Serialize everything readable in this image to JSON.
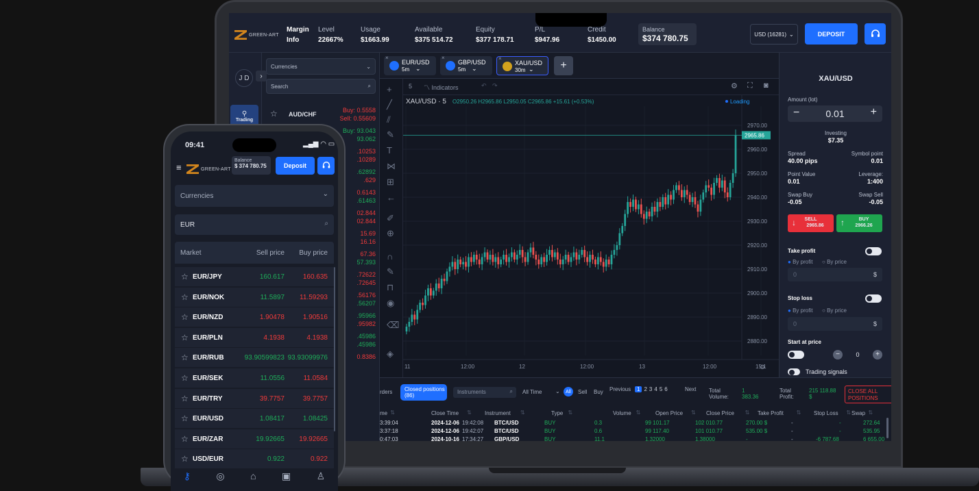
{
  "laptop": {
    "brand": "GREEN-ART",
    "header": {
      "margin_label": "Margin",
      "info_label": "Info",
      "level_label": "Level",
      "level_value": "22667%",
      "usage_label": "Usage",
      "usage_value": "$1663.99",
      "available_label": "Available",
      "available_value": "$375 514.72",
      "equity_label": "Equity",
      "equity_value": "$377 178.71",
      "pl_label": "P/L",
      "pl_value": "$947.96",
      "credit_label": "Credit",
      "credit_value": "$1450.00",
      "balance_label": "Balance",
      "balance_value": "$374 780.75",
      "account_select": "USD (16281)",
      "deposit_label": "DEPOSIT"
    },
    "rail": {
      "avatar": "J D",
      "trading_label": "Trading"
    },
    "watchlist": {
      "category": "Currencies",
      "search_placeholder": "Search",
      "first_symbol": "AUD/CHF",
      "first_buy": "Buy: 0.5558",
      "first_sell": "Sell: 0.55609",
      "rows": [
        {
          "a": "Buy: 93.043",
          "b": "93.062",
          "ca": "green",
          "cb": "green"
        },
        {
          "a": ".10253",
          "b": ".10289",
          "ca": "red",
          "cb": "red"
        },
        {
          "a": ".62892",
          "b": ".629",
          "ca": "green",
          "cb": "red"
        },
        {
          "a": "0.6143",
          "b": ".61463",
          "ca": "red",
          "cb": "green"
        },
        {
          "a": "02.844",
          "b": "02.844",
          "ca": "red",
          "cb": "red"
        },
        {
          "a": "15.69",
          "b": "16.16",
          "ca": "red",
          "cb": "red"
        },
        {
          "a": "67.36",
          "b": "57.393",
          "ca": "red",
          "cb": "green"
        },
        {
          "a": ".72622",
          "b": ".72645",
          "ca": "red",
          "cb": "red"
        },
        {
          "a": ".56176",
          "b": ".56207",
          "ca": "red",
          "cb": "green"
        },
        {
          "a": ".95966",
          "b": ".95982",
          "ca": "green",
          "cb": "red"
        },
        {
          "a": ".45986",
          "b": ".45986",
          "ca": "green",
          "cb": "green"
        },
        {
          "a": "0.8386",
          "b": "",
          "ca": "red",
          "cb": "red"
        }
      ]
    },
    "tabs": [
      {
        "symbol": "EUR/USD",
        "tf": "5m"
      },
      {
        "symbol": "GBP/USD",
        "tf": "5m"
      },
      {
        "symbol": "XAU/USD",
        "tf": "30m"
      }
    ],
    "chart_toolbar": {
      "interval": "5",
      "indicators_label": "Indicators"
    },
    "chart_data": {
      "type": "candlestick",
      "symbol_label": "XAU/USD · 5",
      "ohlc_text": "O2950.26  H2965.86  L2950.05  C2965.86  +15.61 (+0.53%)",
      "status": "Loading",
      "last_price": "2965.86",
      "ylim": [
        2874,
        2978
      ],
      "yticks": [
        "2970.00",
        "2960.00",
        "2950.00",
        "2940.00",
        "2930.00",
        "2920.00",
        "2910.00",
        "2900.00",
        "2890.00",
        "2880.00"
      ],
      "xticks": [
        "11",
        "12:00",
        "12",
        "12:00",
        "13",
        "12:00",
        "15:1"
      ],
      "closes": [
        2886,
        2888,
        2891,
        2889,
        2893,
        2896,
        2895,
        2899,
        2902,
        2899,
        2901,
        2904,
        2902,
        2906,
        2905,
        2909,
        2911,
        2913,
        2910,
        2914,
        2912,
        2913,
        2911,
        2915,
        2913,
        2916,
        2914,
        2912,
        2915,
        2917,
        2914,
        2916,
        2913,
        2915,
        2912,
        2914,
        2916,
        2913,
        2915,
        2917,
        2914,
        2916,
        2918,
        2915,
        2913,
        2917,
        2919,
        2916,
        2914,
        2912,
        2915,
        2913,
        2916,
        2918,
        2915,
        2917,
        2914,
        2912,
        2914,
        2916,
        2913,
        2915,
        2917,
        2914,
        2916,
        2918,
        2915,
        2913,
        2916,
        2914,
        2912,
        2915,
        2913,
        2911,
        2914,
        2912,
        2916,
        2918,
        2920,
        2925,
        2928,
        2933,
        2938,
        2936,
        2939,
        2935,
        2937,
        2933,
        2931,
        2934,
        2932,
        2936,
        2934,
        2938,
        2936,
        2940,
        2937,
        2941,
        2939,
        2943,
        2945,
        2943,
        2940,
        2943,
        2941,
        2938,
        2940,
        2937,
        2934,
        2939,
        2942,
        2945,
        2944,
        2941,
        2946,
        2948,
        2944,
        2947,
        2942,
        2940,
        2946,
        2950,
        2965.86
      ]
    },
    "bottom": {
      "orders_tab": "rders",
      "closed_tab": "Closed positions",
      "closed_count": "(86)",
      "instruments_ph": "Instruments",
      "time_filter": "All Time",
      "filter_all": "All",
      "filter_sell": "Sell",
      "filter_buy": "Buy",
      "prev_label": "Previous",
      "pages": [
        "1",
        "2",
        "3",
        "4",
        "5",
        "6"
      ],
      "next_label": "Next",
      "total_volume_label": "Total Volume:",
      "total_volume": "1 383.36",
      "total_profit_label": "Total Profit:",
      "total_profit": "215 118.88 $",
      "close_all": "CLOSE ALL POSITIONS",
      "columns": [
        "me",
        "Close Time",
        "Instrument",
        "Type",
        "Volume",
        "Open Price",
        "Close Price",
        "Take Profit",
        "Stop Loss",
        "Swap",
        "Final Profit $"
      ],
      "rows": [
        {
          "ot": "3:39:04",
          "cd": "2024-12-06",
          "ct": "19:42:08",
          "inst": "BTC/USD",
          "type": "BUY",
          "vol": "0.3",
          "op": "99 101.17",
          "cp": "102 010.77",
          "tp": "270.00 $",
          "sl": "-",
          "sw": "-",
          "fp": "272.64"
        },
        {
          "ot": "3:37:18",
          "cd": "2024-12-06",
          "ct": "19:42:07",
          "inst": "BTC/USD",
          "type": "BUY",
          "vol": "0.6",
          "op": "99 117.40",
          "cp": "101 010.77",
          "tp": "535.00 $",
          "sl": "-",
          "sw": "-",
          "fp": "535.95"
        },
        {
          "ot": "0:47:03",
          "cd": "2024-10-16",
          "ct": "17:34:27",
          "inst": "GBP/USD",
          "type": "BUY",
          "vol": "11.1",
          "op": "1.32000",
          "cp": "1.38000",
          "tp": "-",
          "sl": "-",
          "sw": "-6 787.68",
          "fp": "6 655.00"
        }
      ]
    },
    "order": {
      "symbol": "XAU/USD",
      "amount_label": "Amount (lot)",
      "amount": "0.01",
      "minus": "−",
      "plus": "+",
      "investing_label": "Investing",
      "investing": "$7.35",
      "spread_label": "Spread",
      "spread": "40.00 pips",
      "symbol_point_label": "Symbol point",
      "symbol_point": "0.01",
      "point_value_label": "Point Value",
      "point_value": "0.01",
      "leverage_label": "Leverage:",
      "leverage": "1:400",
      "swap_buy_label": "Swap Buy",
      "swap_buy": "-0.05",
      "swap_sell_label": "Swap Sell",
      "swap_sell": "-0.05",
      "sell_label": "SELL",
      "sell_price": "2965.86",
      "buy_label": "BUY",
      "buy_price": "2966.26",
      "take_profit_label": "Take profit",
      "by_profit": "By profit",
      "by_price": "By price",
      "input_value": "0",
      "currency": "$",
      "stop_loss_label": "Stop loss",
      "start_price_label": "Start at price",
      "start_value": "0",
      "signals_label": "Trading signals"
    }
  },
  "phone": {
    "time": "09:41",
    "brand": "GREEN-ART",
    "balance_label": "Balance",
    "balance": "$ 374 780.75",
    "deposit_label": "Deposit",
    "category": "Currencies",
    "search_value": "EUR",
    "col_market": "Market",
    "col_sell": "Sell price",
    "col_buy": "Buy price",
    "rows": [
      {
        "sym": "EUR/JPY",
        "sell": "160.617",
        "buy": "160.635",
        "sc": "green",
        "bc": "red"
      },
      {
        "sym": "EUR/NOK",
        "sell": "11.5897",
        "buy": "11.59293",
        "sc": "green",
        "bc": "red"
      },
      {
        "sym": "EUR/NZD",
        "sell": "1.90478",
        "buy": "1.90516",
        "sc": "red",
        "bc": "red"
      },
      {
        "sym": "EUR/PLN",
        "sell": "4.1938",
        "buy": "4.1938",
        "sc": "red",
        "bc": "red"
      },
      {
        "sym": "EUR/RUB",
        "sell": "93.90599823",
        "buy": "93.93099976",
        "sc": "green",
        "bc": "green"
      },
      {
        "sym": "EUR/SEK",
        "sell": "11.0556",
        "buy": "11.0584",
        "sc": "green",
        "bc": "red"
      },
      {
        "sym": "EUR/TRY",
        "sell": "39.7757",
        "buy": "39.7757",
        "sc": "red",
        "bc": "red"
      },
      {
        "sym": "EUR/USD",
        "sell": "1.08417",
        "buy": "1.08425",
        "sc": "green",
        "bc": "green"
      },
      {
        "sym": "EUR/ZAR",
        "sell": "19.92665",
        "buy": "19.92665",
        "sc": "green",
        "bc": "red"
      },
      {
        "sym": "USD/EUR",
        "sell": "0.922",
        "buy": "0.922",
        "sc": "green",
        "bc": "red"
      }
    ]
  },
  "colors": {
    "accent": "#1f6fff",
    "up": "#1fae5a",
    "down": "#f23b3b",
    "brand": "#d3861d"
  }
}
